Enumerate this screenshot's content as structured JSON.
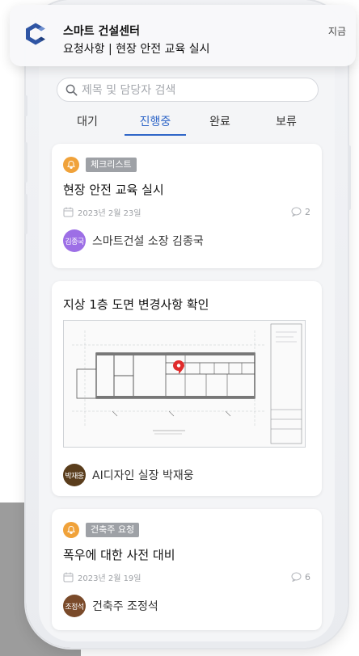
{
  "notification": {
    "app_name": "스마트 건설센터",
    "message": "요청사항 | 현장 안전 교육 실시",
    "time": "지금",
    "logo_icon": "c-logo-icon",
    "logo_color": "#2f55a4"
  },
  "search": {
    "placeholder": "제목 및 담당자 검색"
  },
  "tabs": [
    {
      "label": "대기",
      "active": false
    },
    {
      "label": "진행중",
      "active": true
    },
    {
      "label": "완료",
      "active": false
    },
    {
      "label": "보류",
      "active": false
    }
  ],
  "colors": {
    "accent": "#2f66c8",
    "tag_gray": "#9ea1a6",
    "bell_orange": "#f0a23a"
  },
  "cards": [
    {
      "tag": "체크리스트",
      "title": "현장 안전 교육 실시",
      "date": "2023년 2월 23일",
      "comments": "2",
      "avatar_label": "김종국",
      "avatar_color": "#9d6fe6",
      "user": "스마트건설 소장 김종국"
    },
    {
      "title": "지상 1층 도면 변경사항 확인",
      "avatar_label": "박재웅",
      "avatar_color": "#5a3d1c",
      "user": "AI디자인 실장 박재웅"
    },
    {
      "tag": "건축주 요청",
      "title": "폭우에 대한 사전 대비",
      "date": "2023년 2월 19일",
      "comments": "6",
      "avatar_label": "조정석",
      "avatar_color": "#7a4a2a",
      "user": "건축주 조정석"
    }
  ]
}
